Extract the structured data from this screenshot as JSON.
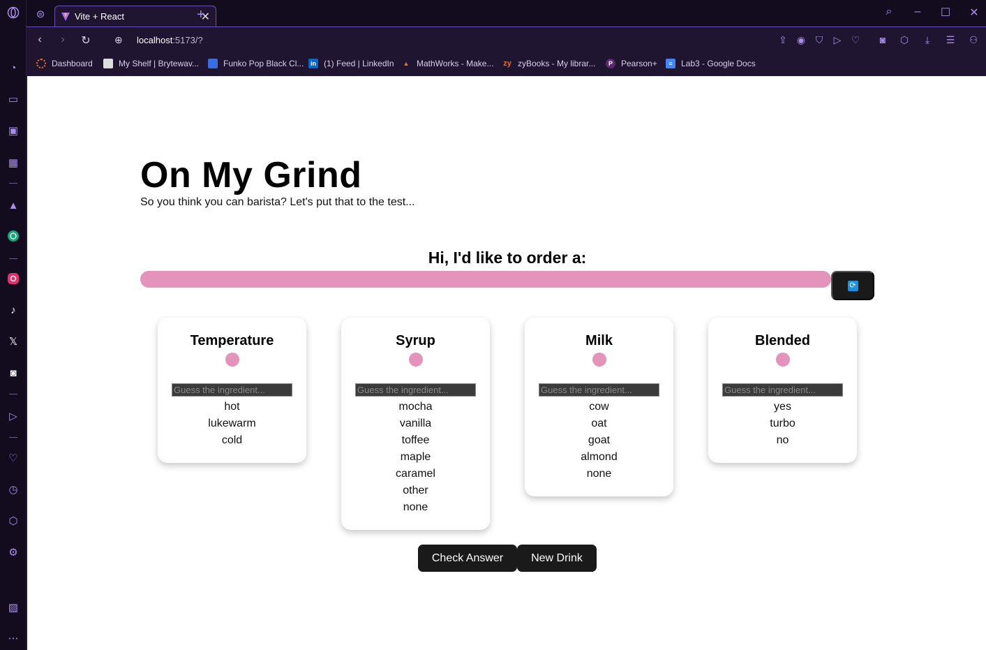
{
  "browser": {
    "tab_title": "Vite + React",
    "url_host": "localhost",
    "url_path": ":5173/?",
    "bookmarks": [
      {
        "label": "Dashboard",
        "color": "#e8702a"
      },
      {
        "label": "My Shelf | Brytewav...",
        "color": "#dddddd"
      },
      {
        "label": "Funko Pop Black Cl...",
        "color": "#3a6de0"
      },
      {
        "label": "(1) Feed | LinkedIn",
        "color": "#0a66c2"
      },
      {
        "label": "MathWorks - Make...",
        "color": "#e87a2a"
      },
      {
        "label": "zyBooks - My librar...",
        "color": "#e8702a"
      },
      {
        "label": "Pearson+",
        "color": "#5a2a6a"
      },
      {
        "label": "Lab3 - Google Docs",
        "color": "#4285f4"
      }
    ]
  },
  "app": {
    "title": "On My Grind",
    "subtitle": "So you think you can barista? Let's put that to the test...",
    "order_heading": "Hi, I'd like to order a:",
    "guess_placeholder": "Guess the ingredient...",
    "cards": [
      {
        "title": "Temperature",
        "options": [
          "hot",
          "lukewarm",
          "cold"
        ]
      },
      {
        "title": "Syrup",
        "options": [
          "mocha",
          "vanilla",
          "toffee",
          "maple",
          "caramel",
          "other",
          "none"
        ]
      },
      {
        "title": "Milk",
        "options": [
          "cow",
          "oat",
          "goat",
          "almond",
          "none"
        ]
      },
      {
        "title": "Blended",
        "options": [
          "yes",
          "turbo",
          "no"
        ]
      }
    ],
    "check_label": "Check Answer",
    "new_drink_label": "New Drink"
  },
  "colors": {
    "accent_pink": "#e493bb",
    "button_dark": "#1a1a1a",
    "browser_purple": "#a98ee8"
  }
}
